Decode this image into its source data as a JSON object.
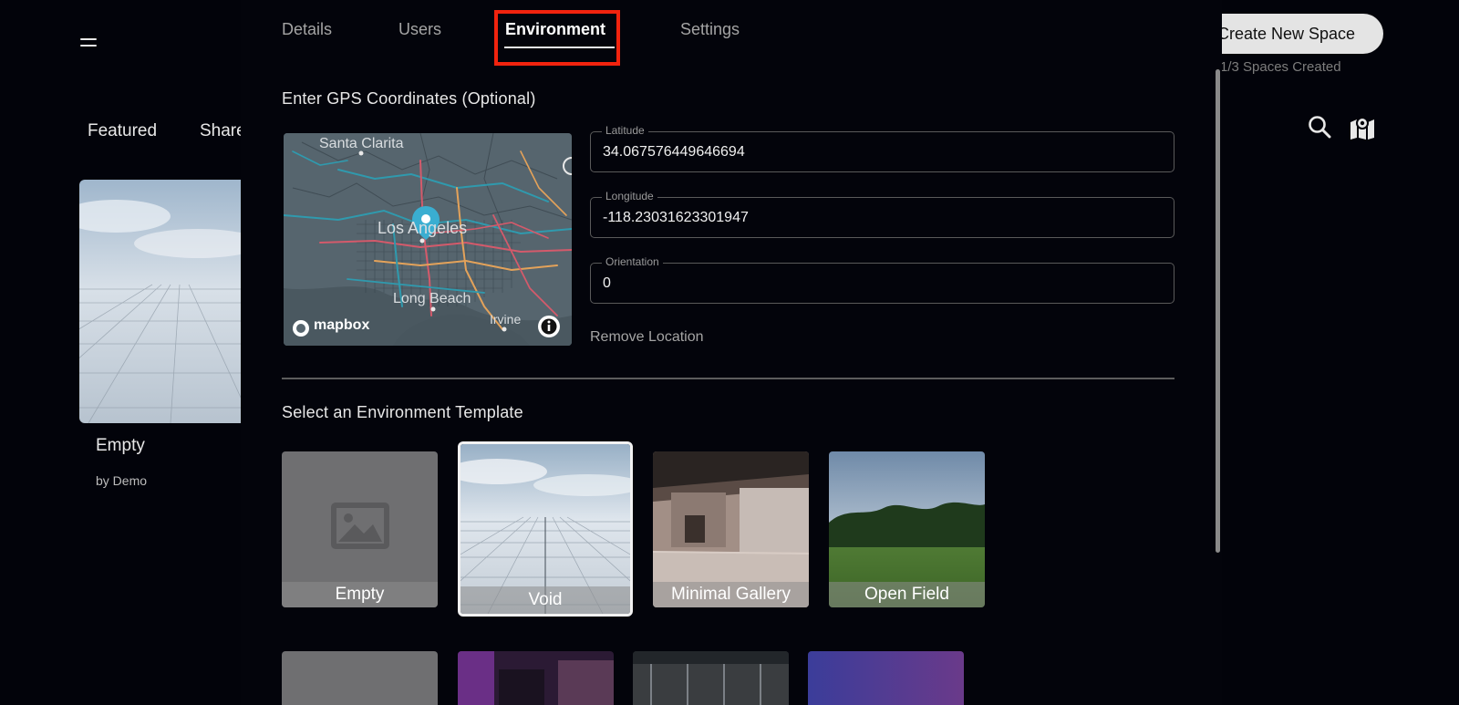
{
  "background": {
    "nav_tabs": [
      "Featured",
      "Share"
    ],
    "card": {
      "title": "Empty",
      "author": "by Demo"
    },
    "create_button_label": "Create New Space",
    "spaces_created": "1/3 Spaces Created",
    "icons": [
      "search-icon",
      "map-icon",
      "hamburger-menu-icon"
    ]
  },
  "modal": {
    "tabs": [
      {
        "label": "Details",
        "active": false
      },
      {
        "label": "Users",
        "active": false
      },
      {
        "label": "Environment",
        "active": true
      },
      {
        "label": "Settings",
        "active": false
      }
    ],
    "gps": {
      "heading": "Enter GPS Coordinates (Optional)",
      "map": {
        "labels": [
          "Santa Clarita",
          "Los Angeles",
          "Long Beach",
          "Irvine"
        ],
        "attribution": "mapbox"
      },
      "latitude": {
        "label": "Latitude",
        "value": "34.067576449646694"
      },
      "longitude": {
        "label": "Longitude",
        "value": "-118.23031623301947"
      },
      "orientation": {
        "label": "Orientation",
        "value": "0"
      },
      "remove_label": "Remove Location"
    },
    "templates": {
      "heading": "Select an Environment Template",
      "items": [
        {
          "label": "Empty",
          "selected": false
        },
        {
          "label": "Void",
          "selected": true
        },
        {
          "label": "Minimal Gallery",
          "selected": false
        },
        {
          "label": "Open Field",
          "selected": false
        }
      ]
    }
  },
  "colors": {
    "highlight_box": "#f2230e",
    "marker": "#3aaed1",
    "background": "#03040b"
  }
}
